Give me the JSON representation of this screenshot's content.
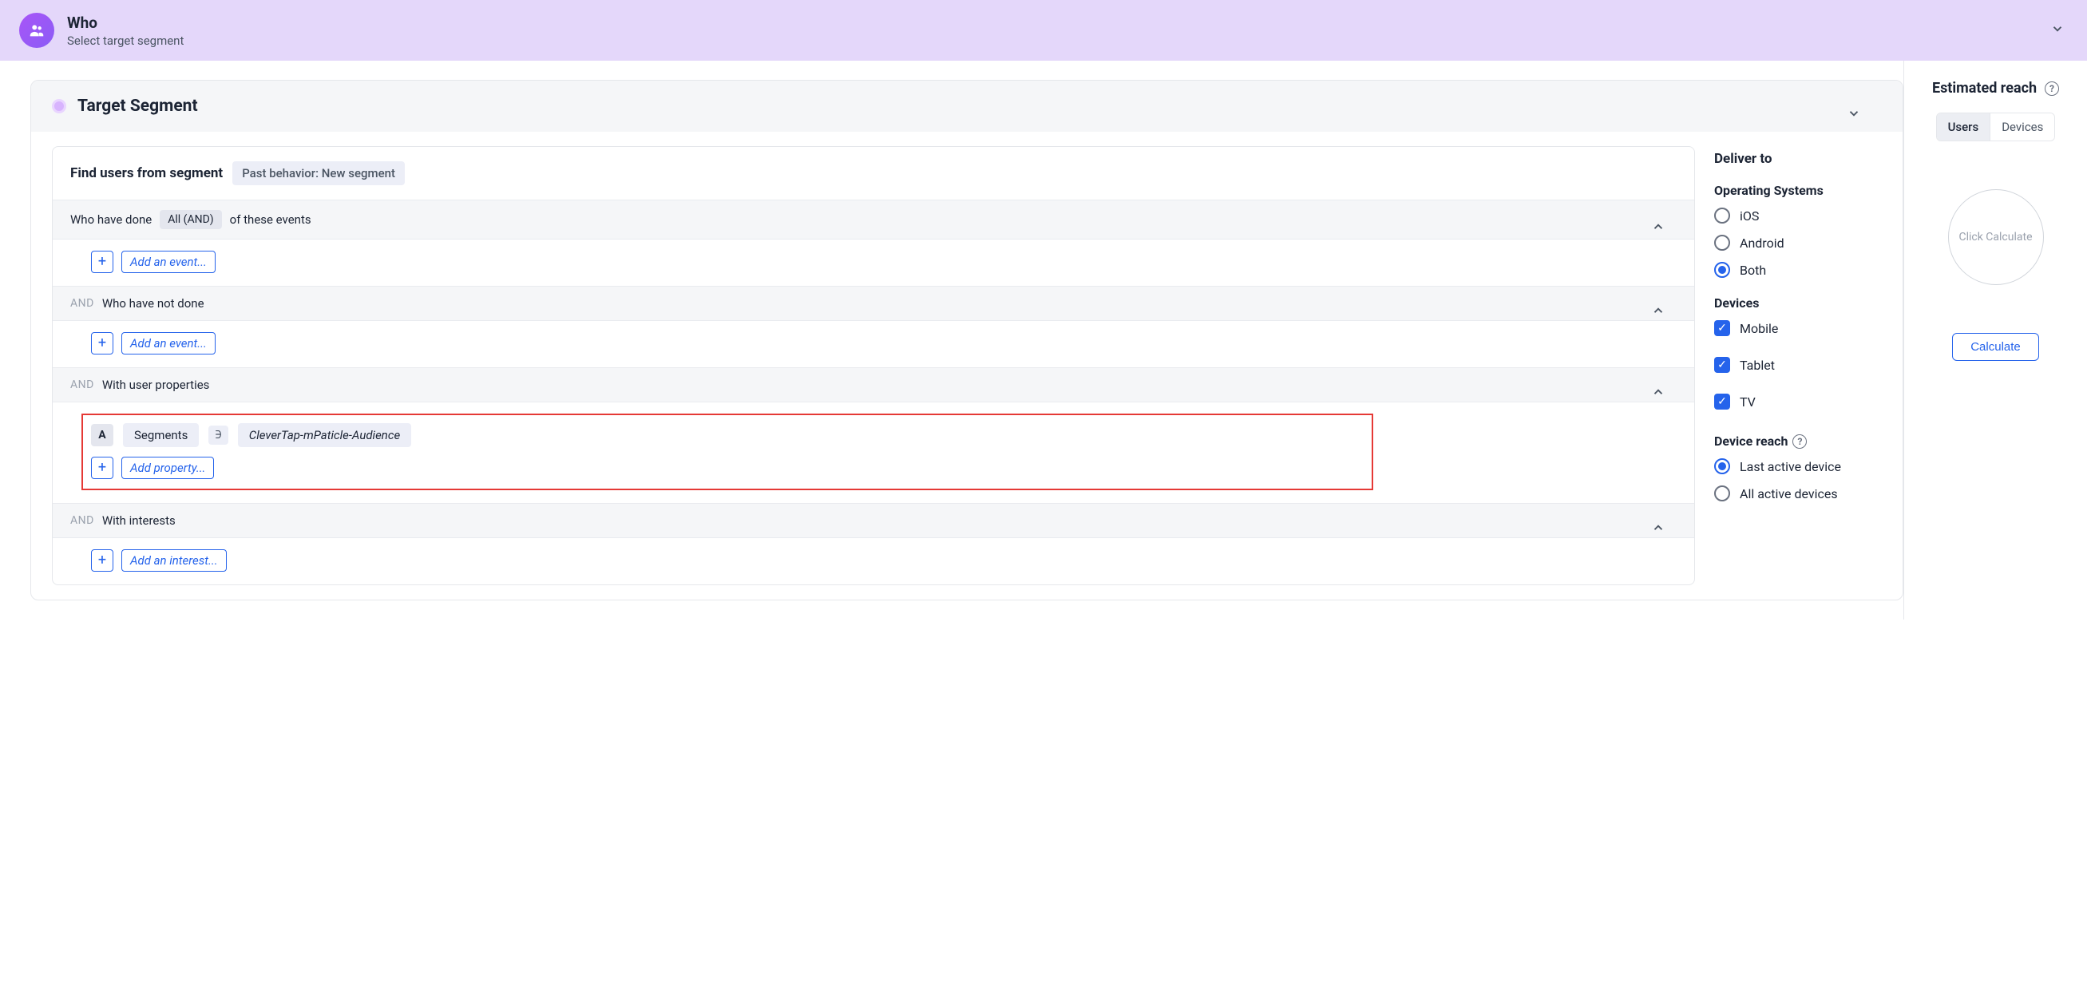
{
  "header": {
    "title": "Who",
    "subtitle": "Select target segment"
  },
  "target": {
    "title": "Target Segment",
    "find_label": "Find users from segment",
    "segment_badge": "Past behavior: New segment"
  },
  "conditions": {
    "and_label": "AND",
    "done": {
      "prefix": "Who have done",
      "operator": "All (AND)",
      "suffix": "of these events",
      "add_label": "Add an event..."
    },
    "not_done": {
      "label": "Who have not done",
      "add_label": "Add an event..."
    },
    "user_props": {
      "label": "With user properties",
      "letter": "A",
      "prop_name": "Segments",
      "operator_sym": "∋",
      "prop_value": "CleverTap-mPaticle-Audience",
      "add_label": "Add property..."
    },
    "interests": {
      "label": "With interests",
      "add_label": "Add an interest..."
    }
  },
  "deliver": {
    "title": "Deliver to",
    "os": {
      "title": "Operating Systems",
      "options": [
        "iOS",
        "Android",
        "Both"
      ],
      "selected": "Both"
    },
    "devices": {
      "title": "Devices",
      "options": [
        "Mobile",
        "Tablet",
        "TV"
      ]
    },
    "reach": {
      "title": "Device reach",
      "options": [
        "Last active device",
        "All active devices"
      ],
      "selected": "Last active device"
    }
  },
  "sidebar": {
    "title": "Estimated reach",
    "tab_users": "Users",
    "tab_devices": "Devices",
    "circle_text": "Click Calculate",
    "calc_button": "Calculate"
  }
}
